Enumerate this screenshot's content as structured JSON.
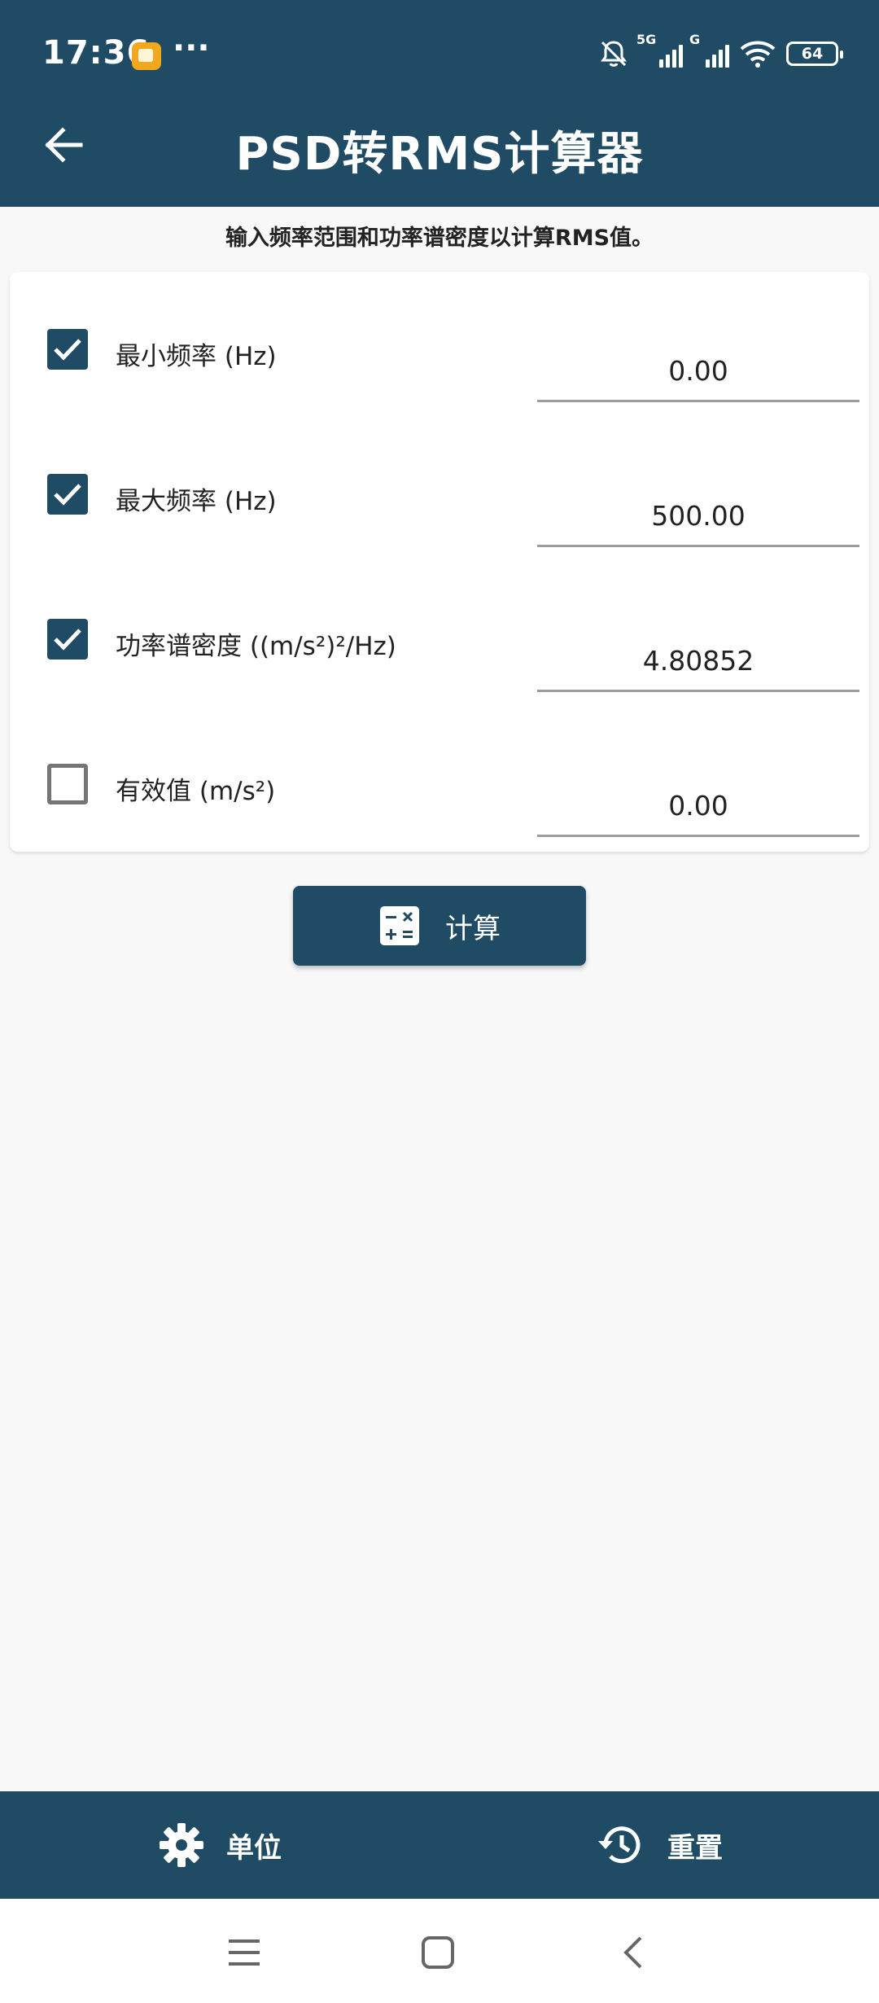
{
  "status_bar": {
    "time": "17:36",
    "more": "···",
    "network_1": "5G",
    "network_2": "G",
    "battery": "64"
  },
  "app_bar": {
    "title": "PSD转RMS计算器",
    "back_icon": "arrow-left-icon"
  },
  "subtitle": "输入频率范围和功率谱密度以计算RMS值。",
  "fields": [
    {
      "label": "最小频率 (Hz)",
      "value": "0.00",
      "checked": true
    },
    {
      "label": "最大频率 (Hz)",
      "value": "500.00",
      "checked": true
    },
    {
      "label": "功率谱密度 ((m/s²)²/Hz)",
      "value": "4.80852",
      "checked": true
    },
    {
      "label": "有效值 (m/s²)",
      "value": "0.00",
      "checked": false
    }
  ],
  "calculate_button": {
    "label": "计算",
    "icon": "calculator-icon"
  },
  "bottom_bar": {
    "units": {
      "label": "单位",
      "icon": "gear-icon"
    },
    "reset": {
      "label": "重置",
      "icon": "history-icon"
    }
  },
  "colors": {
    "primary": "#1f4b64",
    "background": "#f8f8f8"
  }
}
